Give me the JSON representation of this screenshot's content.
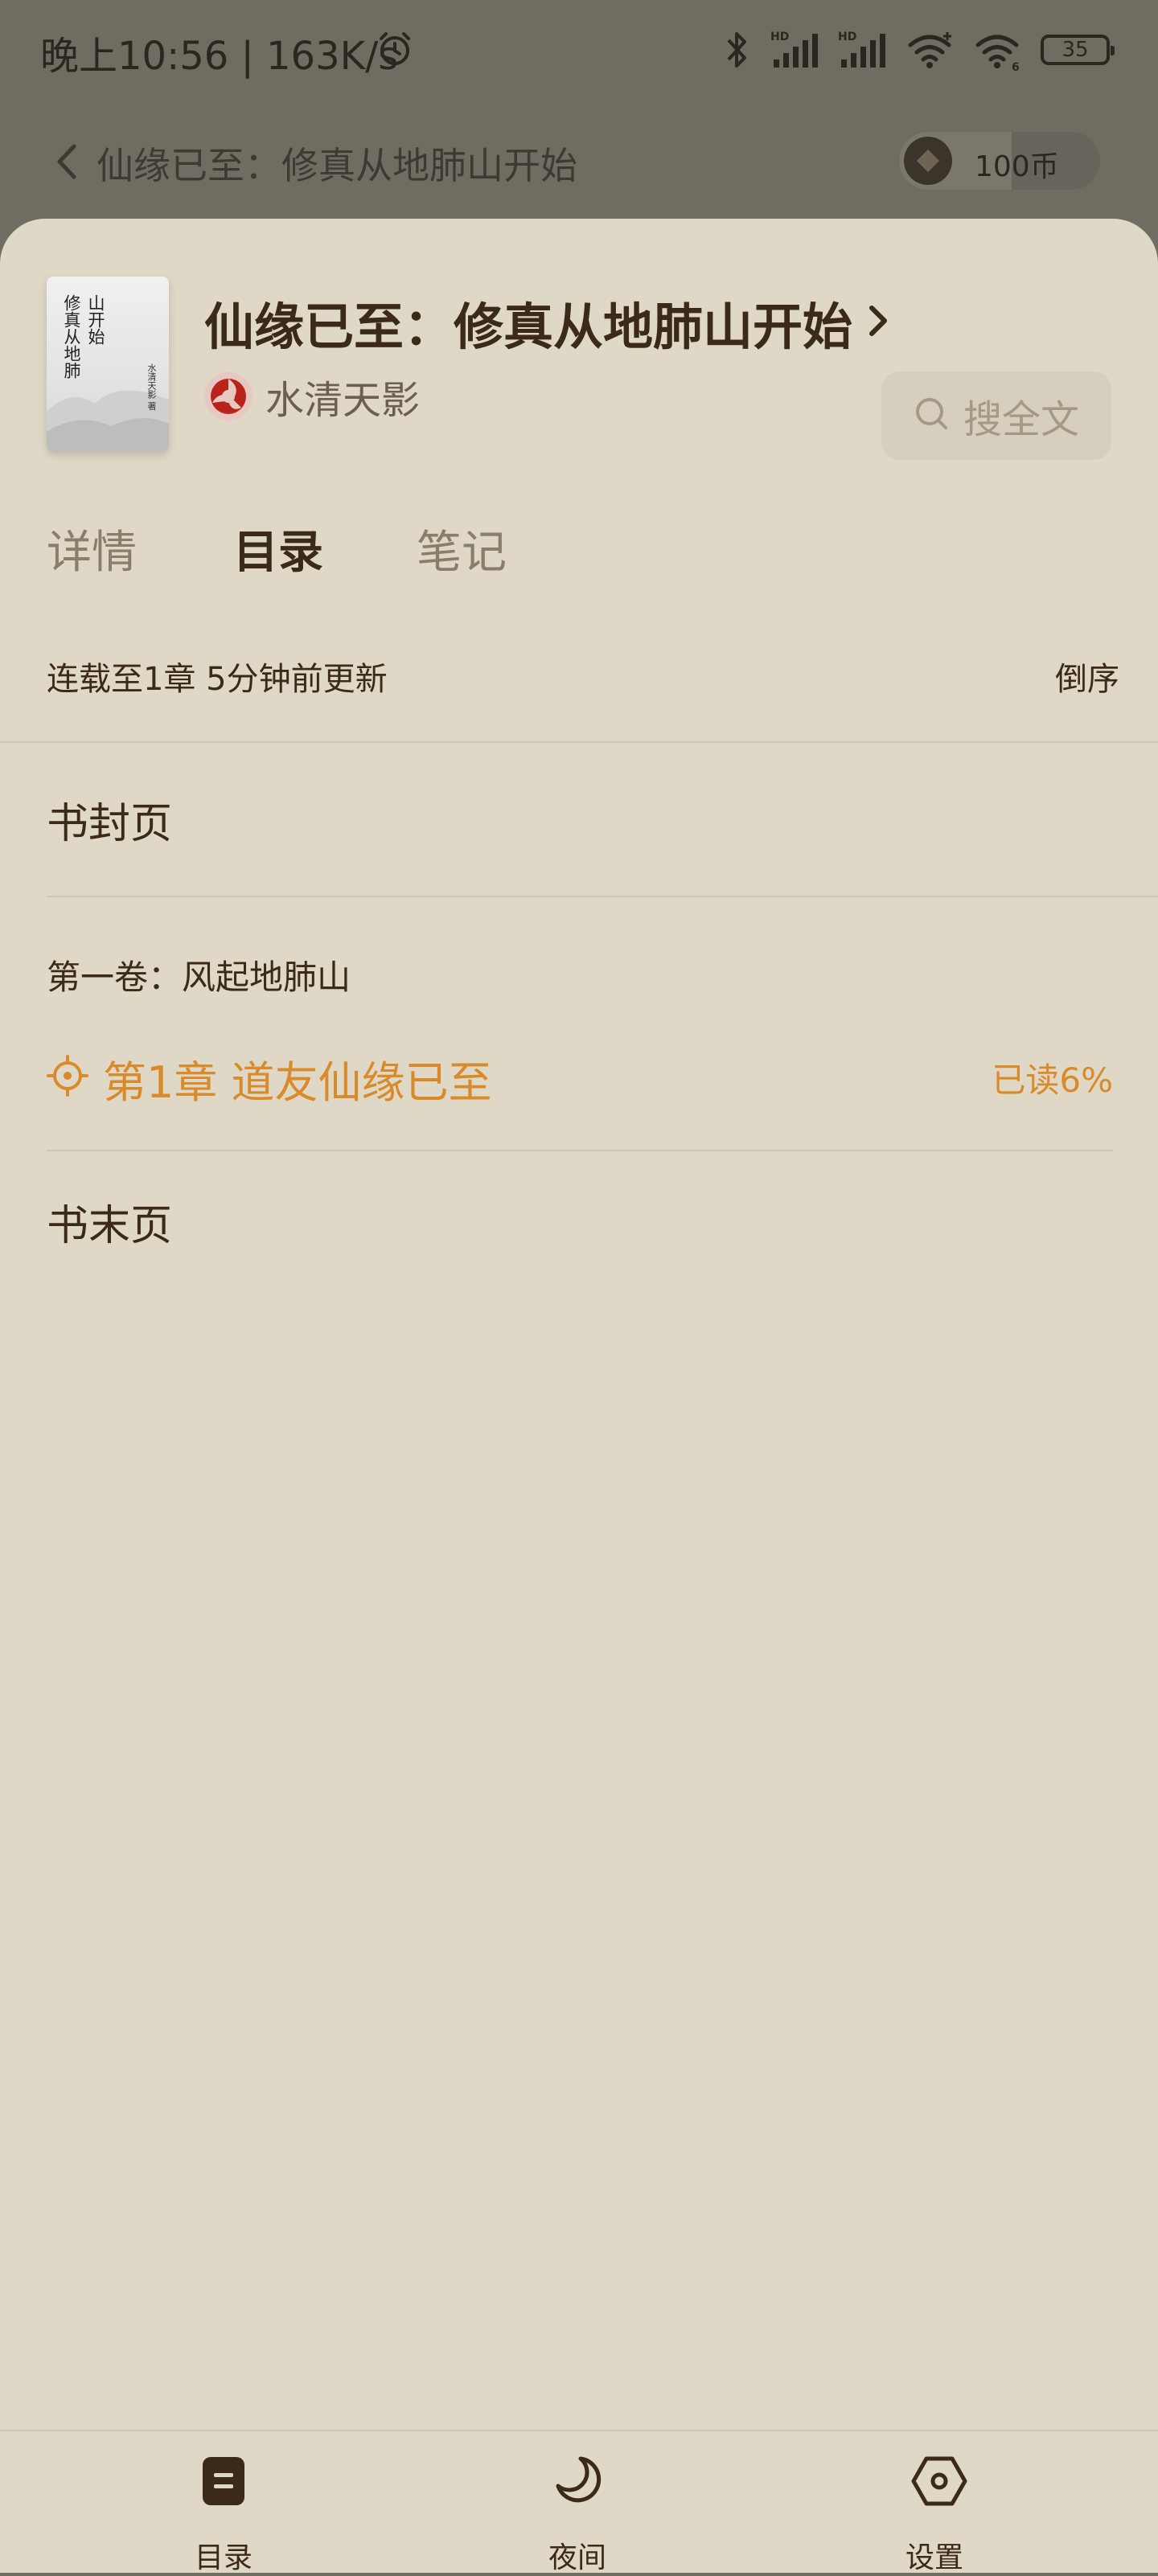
{
  "status_bar": {
    "time_and_speed": "晚上10:56 | 163K/s",
    "battery": "35"
  },
  "reader_header": {
    "title": "仙缘已至：修真从地肺山开始",
    "coins": "100币"
  },
  "book": {
    "title": "仙缘已至：修真从地肺山开始",
    "author": "水清天影",
    "cover_title_col1": "修真从地肺",
    "cover_title_col2": "山开始",
    "cover_author": "水清天影 著"
  },
  "search": {
    "label": "搜全文"
  },
  "tabs": [
    {
      "label": "详情",
      "active": false
    },
    {
      "label": "目录",
      "active": true
    },
    {
      "label": "笔记",
      "active": false
    }
  ],
  "toc": {
    "meta": "连载至1章 5分钟前更新",
    "order_label": "倒序",
    "cover_page": "书封页",
    "volume": "第一卷：风起地肺山",
    "chapter_title": "第1章 道友仙缘已至",
    "chapter_progress": "已读6%",
    "end_page": "书末页"
  },
  "bottom_nav": [
    {
      "label": "目录",
      "icon": "toc-icon"
    },
    {
      "label": "夜间",
      "icon": "moon-icon"
    },
    {
      "label": "设置",
      "icon": "settings-hexagon-icon"
    }
  ],
  "colors": {
    "sheet_background": "#dfd8c6",
    "primary_text": "#3b2a17",
    "accent_orange": "#d98a2a",
    "dim_overlay": "#6f6c62"
  }
}
